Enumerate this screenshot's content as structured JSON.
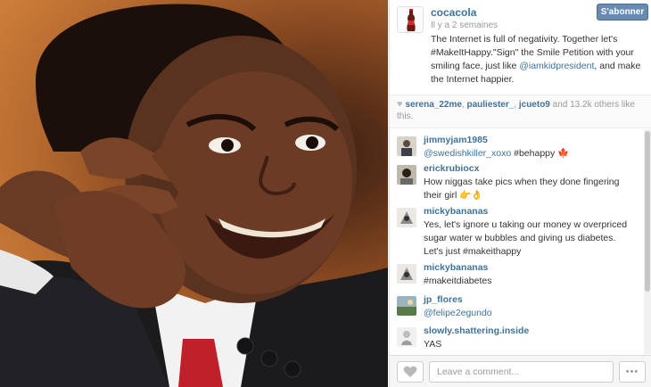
{
  "post": {
    "username": "cocacola",
    "time": "Il y a 2 semaines",
    "follow_label": "S'abonner",
    "caption_part1": "The Internet is full of negativity. Together let's #MakeItHappy.\"Sign\" the Smile Petition with your smiling face, just like ",
    "caption_mention": "@iamkidpresident",
    "caption_part2": ", and make the Internet happier."
  },
  "likes": {
    "user1": "serena_22me",
    "sep1": ", ",
    "user2": "pauliester_",
    "sep2": ", ",
    "user3": "jcueto9",
    "suffix": " and 13.2k others like this."
  },
  "comments": [
    {
      "user": "jimmyjam1985",
      "text": "@swedishkiller_xoxo #behappy 🍁",
      "mention": "@swedishkiller_xoxo",
      "rest": " #behappy 🍁"
    },
    {
      "user": "erickrubiocx",
      "text": "How niggas take pics when they done fingering their girl 👉👌"
    },
    {
      "user": "mickybananas",
      "text": "Yes, let's ignore u taking our money w overpriced sugar water w bubbles and giving us diabetes. Let's just #makeithappy"
    },
    {
      "user": "mickybananas",
      "text": "#makeitdiabetes"
    },
    {
      "user": "jp_flores",
      "mention": "@felipe2egundo"
    },
    {
      "user": "slowly.shattering.inside",
      "text": "YAS"
    }
  ],
  "footer": {
    "comment_placeholder": "Leave a comment...",
    "more_label": "•••"
  },
  "colors": {
    "link": "#3f729b",
    "follow_button": "#6a8bb0"
  },
  "icons": {
    "like": "heart-icon",
    "more": "ellipsis-icon",
    "avatar": "coca-cola-bottle-icon"
  }
}
